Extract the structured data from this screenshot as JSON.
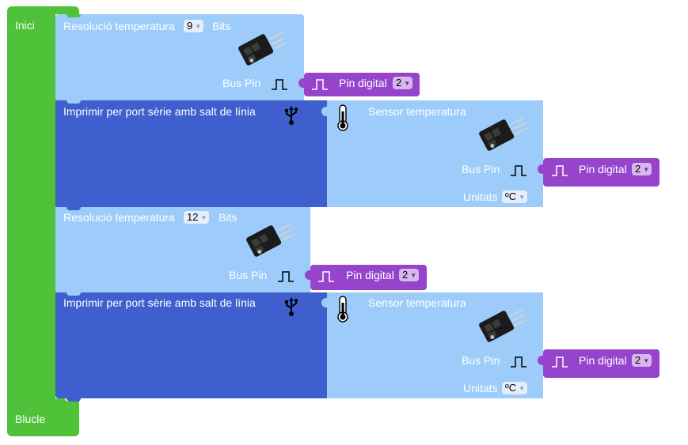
{
  "inici": {
    "label": "Inici"
  },
  "blucle": {
    "label": "Blucle"
  },
  "blocks": {
    "resolution1": {
      "label": "Resolució temperatura",
      "value": "9",
      "unit": "Bits",
      "bus_label": "Bus Pin",
      "pin": {
        "label": "Pin digital",
        "value": "2"
      }
    },
    "print1": {
      "label": "Imprimir per port sèrie amb salt de línia",
      "sensor": {
        "label": "Sensor temperatura",
        "bus_label": "Bus Pin",
        "pin": {
          "label": "Pin digital",
          "value": "2"
        },
        "units_label": "Unitats",
        "units_value": "ºC"
      }
    },
    "resolution2": {
      "label": "Resolució temperatura",
      "value": "12",
      "unit": "Bits",
      "bus_label": "Bus Pin",
      "pin": {
        "label": "Pin digital",
        "value": "2"
      }
    },
    "print2": {
      "label": "Imprimir per port sèrie amb salt de línia",
      "sensor": {
        "label": "Sensor temperatura",
        "bus_label": "Bus Pin",
        "pin": {
          "label": "Pin digital",
          "value": "2"
        },
        "units_label": "Unitats",
        "units_value": "ºC"
      }
    }
  },
  "icons": {
    "sensor": "temperature-sensor-module-icon",
    "pulse": "digital-pulse-icon",
    "usb": "usb-icon",
    "thermometer": "thermometer-icon",
    "dropdown": "dropdown-arrow-icon"
  },
  "colors": {
    "green": "#4fc23a",
    "light_blue": "#9dccfb",
    "dark_blue": "#3e5fcd",
    "purple": "#9744cc"
  }
}
